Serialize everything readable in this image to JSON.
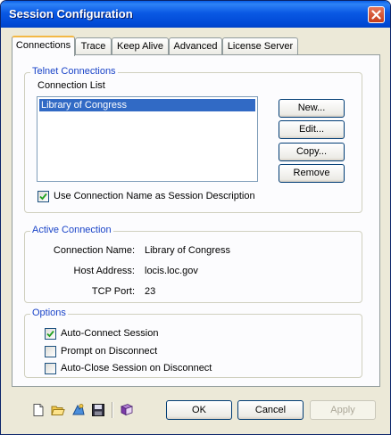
{
  "window": {
    "title": "Session Configuration"
  },
  "tabs": [
    "Connections",
    "Trace",
    "Keep Alive",
    "Advanced",
    "License Server"
  ],
  "telnet": {
    "group_label": "Telnet Connections",
    "list_label": "Connection List",
    "items": [
      "Library of Congress"
    ],
    "buttons": {
      "new": "New...",
      "edit": "Edit...",
      "copy": "Copy...",
      "remove": "Remove"
    },
    "use_name_label": "Use Connection Name as Session Description",
    "use_name_checked": true
  },
  "active": {
    "group_label": "Active Connection",
    "name_label": "Connection Name:",
    "name_value": "Library of Congress",
    "host_label": "Host Address:",
    "host_value": "locis.loc.gov",
    "port_label": "TCP Port:",
    "port_value": "23"
  },
  "options": {
    "group_label": "Options",
    "items": [
      {
        "label": "Auto-Connect Session",
        "checked": true
      },
      {
        "label": "Prompt on Disconnect",
        "checked": false
      },
      {
        "label": "Auto-Close Session on Disconnect",
        "checked": false
      }
    ]
  },
  "toolbar": {
    "icons": [
      "new-document-icon",
      "open-folder-icon",
      "import-icon",
      "save-disk-icon",
      "book-icon"
    ]
  },
  "footer": {
    "ok": "OK",
    "cancel": "Cancel",
    "apply": "Apply"
  },
  "colors": {
    "title_bar": "#0a59e4",
    "group_label": "#1a44c8",
    "selection": "#316ac5",
    "tab_highlight": "#f3b845"
  }
}
